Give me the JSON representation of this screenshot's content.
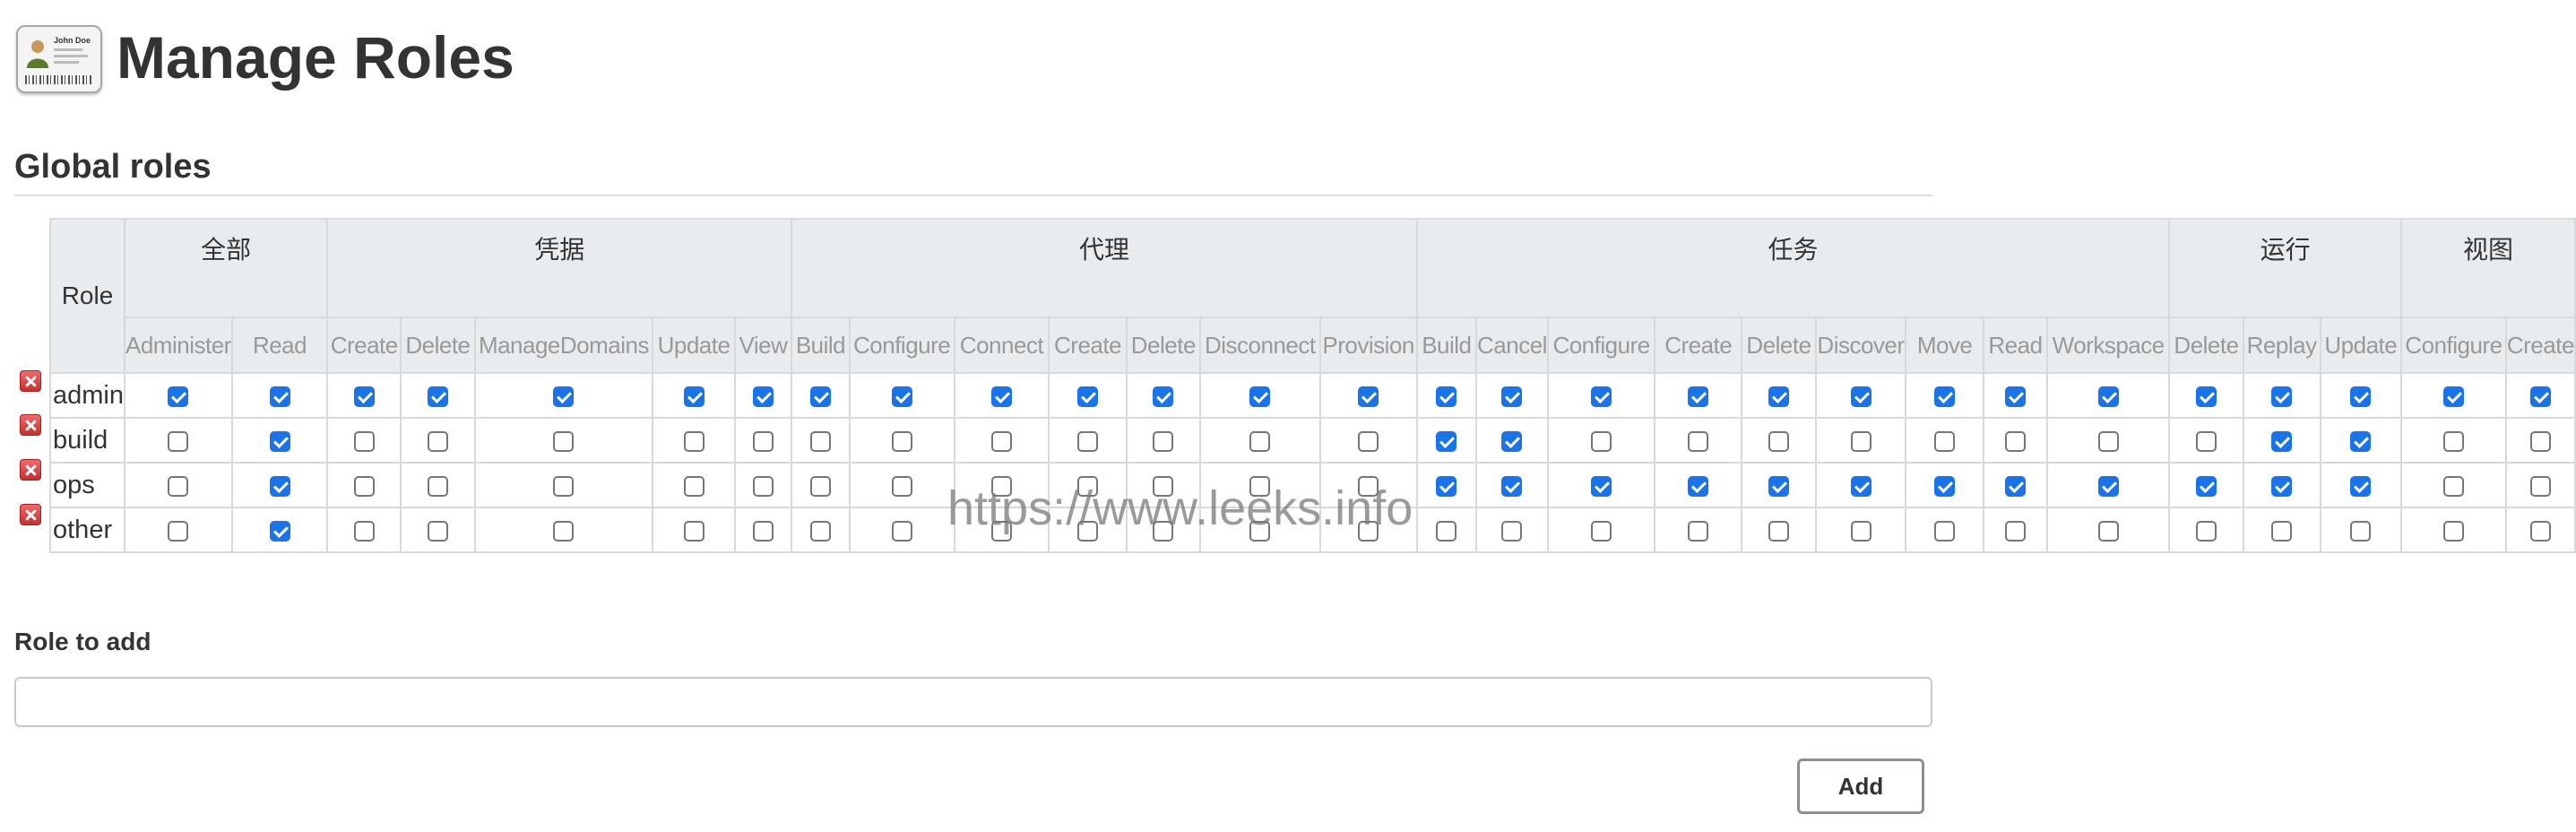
{
  "page": {
    "title": "Manage Roles",
    "icon": "id-card-icon",
    "icon_card_name": "John Doe"
  },
  "global_roles": {
    "section_title": "Global roles",
    "role_header": "Role",
    "groups": [
      {
        "label": "全部",
        "permissions": [
          "Administer",
          "Read"
        ]
      },
      {
        "label": "凭据",
        "permissions": [
          "Create",
          "Delete",
          "ManageDomains",
          "Update",
          "View"
        ]
      },
      {
        "label": "代理",
        "permissions": [
          "Build",
          "Configure",
          "Connect",
          "Create",
          "Delete",
          "Disconnect",
          "Provision"
        ]
      },
      {
        "label": "任务",
        "permissions": [
          "Build",
          "Cancel",
          "Configure",
          "Create",
          "Delete",
          "Discover",
          "Move",
          "Read",
          "Workspace"
        ]
      },
      {
        "label": "运行",
        "permissions": [
          "Delete",
          "Replay",
          "Update"
        ]
      },
      {
        "label": "视图",
        "permissions": [
          "Configure",
          "Create"
        ]
      }
    ],
    "roles": [
      {
        "name": "admin",
        "checked": [
          1,
          1,
          1,
          1,
          1,
          1,
          1,
          1,
          1,
          1,
          1,
          1,
          1,
          1,
          1,
          1,
          1,
          1,
          1,
          1,
          1,
          1,
          1,
          1,
          1,
          1,
          1,
          1
        ]
      },
      {
        "name": "build",
        "checked": [
          0,
          1,
          0,
          0,
          0,
          0,
          0,
          0,
          0,
          0,
          0,
          0,
          0,
          0,
          1,
          1,
          0,
          0,
          0,
          0,
          0,
          0,
          0,
          0,
          1,
          1,
          0,
          0
        ]
      },
      {
        "name": "ops",
        "checked": [
          0,
          1,
          0,
          0,
          0,
          0,
          0,
          0,
          0,
          0,
          0,
          0,
          0,
          0,
          1,
          1,
          1,
          1,
          1,
          1,
          1,
          1,
          1,
          1,
          1,
          1,
          0,
          0
        ]
      },
      {
        "name": "other",
        "checked": [
          0,
          1,
          0,
          0,
          0,
          0,
          0,
          0,
          0,
          0,
          0,
          0,
          0,
          0,
          0,
          0,
          0,
          0,
          0,
          0,
          0,
          0,
          0,
          0,
          0,
          0,
          0,
          0
        ]
      }
    ]
  },
  "watermark": "https://www.leeks.info",
  "add_role": {
    "label": "Role to add",
    "value": "",
    "placeholder": "",
    "button_label": "Add"
  },
  "colors": {
    "checkbox_checked": "#1a73e8",
    "header_bg": "#e9ecef",
    "delete_icon": "#c43030"
  }
}
